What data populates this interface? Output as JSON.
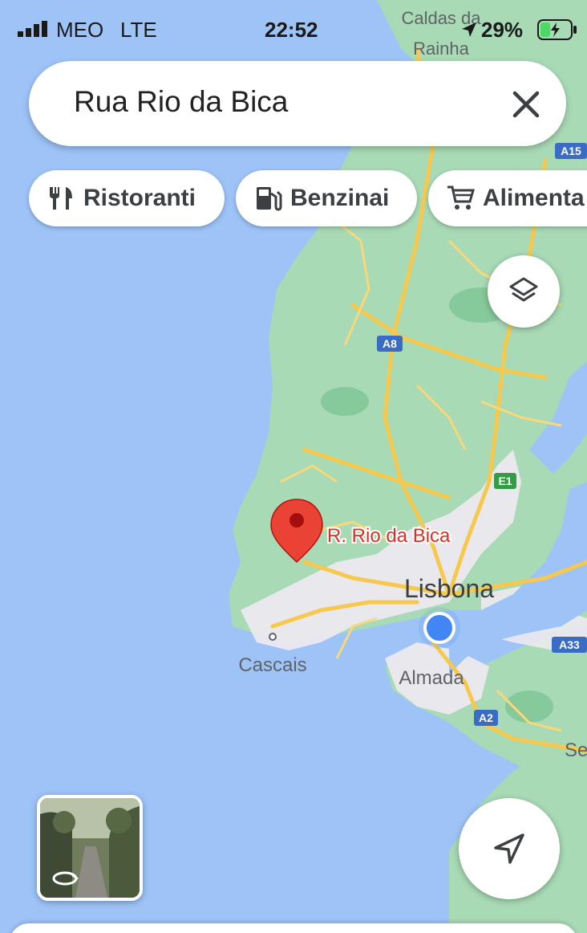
{
  "status_bar": {
    "carrier": "MEO",
    "network": "LTE",
    "time": "22:52",
    "battery": "29%"
  },
  "search": {
    "query": "Rua Rio da Bica"
  },
  "chips": [
    {
      "label": "Ristoranti",
      "icon": "restaurant-icon"
    },
    {
      "label": "Benzinai",
      "icon": "gas-station-icon"
    },
    {
      "label": "Alimenta",
      "icon": "cart-icon"
    }
  ],
  "map": {
    "pin_label": "R. Rio da Bica",
    "places": {
      "lisbon": "Lisbona",
      "cascais": "Cascais",
      "almada": "Almada",
      "caldas_line1": "Caldas da",
      "caldas_line2": "Rainha",
      "setubal_partial": "Se"
    },
    "road_shields": {
      "a8": "A8",
      "a15": "A15",
      "e1": "E1",
      "a33": "A33",
      "a2": "A2"
    },
    "colors": {
      "water": "#9dc3f7",
      "land": "#a8dab5",
      "urban": "#ece9f0",
      "road": "#f6c84d",
      "pin": "#ea4335",
      "location": "#4285f4"
    }
  }
}
